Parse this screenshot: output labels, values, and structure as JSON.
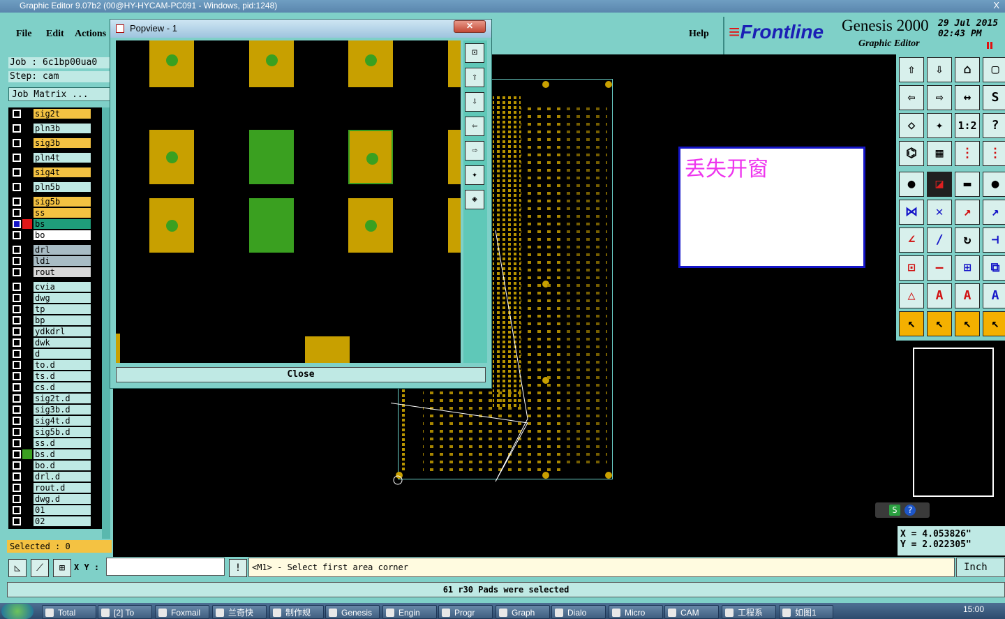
{
  "window": {
    "title": "Graphic Editor 9.07b2 (00@HY-HYCAM-PC091 - Windows, pid:1248)",
    "close_glyph": "X"
  },
  "menu": {
    "items": [
      "File",
      "Edit",
      "Actions"
    ],
    "help": "Help"
  },
  "brand": {
    "logo": "Frontline",
    "product": "Genesis 2000",
    "subtitle": "Graphic Editor",
    "date": "29 Jul 2015",
    "time": "02:43 PM"
  },
  "job": {
    "job_line": "Job : 6c1bp00ua0",
    "step_line": "Step: cam",
    "matrix_button": "Job Matrix ..."
  },
  "layers": [
    {
      "name": "sig2t",
      "bg": "#f4c242",
      "color": "#000000",
      "checked": false
    },
    {
      "name": "pln3b",
      "bg": "#bfe9e4",
      "color": "#000000",
      "checked": false
    },
    {
      "name": "sig3b",
      "bg": "#f4c242",
      "color": "#000000",
      "checked": false
    },
    {
      "name": "pln4t",
      "bg": "#bfe9e4",
      "color": "#000000",
      "checked": false
    },
    {
      "name": "sig4t",
      "bg": "#f4c242",
      "color": "#000000",
      "checked": false
    },
    {
      "name": "pln5b",
      "bg": "#bfe9e4",
      "color": "#000000",
      "checked": false
    },
    {
      "name": "sig5b",
      "bg": "#f4c242",
      "color": "#000000",
      "checked": false
    },
    {
      "name": "ss",
      "bg": "#f4c242",
      "color": "#000000",
      "checked": false
    },
    {
      "name": "bs",
      "bg": "#1f9e7a",
      "color": "#e01818",
      "checked": true
    },
    {
      "name": "bo",
      "bg": "#ffffff",
      "color": "#000000",
      "checked": false
    },
    {
      "name": "drl",
      "bg": "#a8bcc4",
      "color": "#000000",
      "checked": false
    },
    {
      "name": "ldi",
      "bg": "#a8bcc4",
      "color": "#000000",
      "checked": false
    },
    {
      "name": "rout",
      "bg": "#d8d8d8",
      "color": "#000000",
      "checked": false
    },
    {
      "name": "cvia",
      "bg": "#bfe9e4",
      "color": "#000000",
      "checked": false
    },
    {
      "name": "dwg",
      "bg": "#bfe9e4",
      "color": "#000000",
      "checked": false
    },
    {
      "name": "tp",
      "bg": "#bfe9e4",
      "color": "#000000",
      "checked": false
    },
    {
      "name": "bp",
      "bg": "#bfe9e4",
      "color": "#000000",
      "checked": false
    },
    {
      "name": "ydkdrl",
      "bg": "#bfe9e4",
      "color": "#000000",
      "checked": false
    },
    {
      "name": "dwk",
      "bg": "#bfe9e4",
      "color": "#000000",
      "checked": false
    },
    {
      "name": "d",
      "bg": "#bfe9e4",
      "color": "#000000",
      "checked": false
    },
    {
      "name": "to.d",
      "bg": "#bfe9e4",
      "color": "#000000",
      "checked": false
    },
    {
      "name": "ts.d",
      "bg": "#bfe9e4",
      "color": "#000000",
      "checked": false
    },
    {
      "name": "cs.d",
      "bg": "#bfe9e4",
      "color": "#000000",
      "checked": false
    },
    {
      "name": "sig2t.d",
      "bg": "#bfe9e4",
      "color": "#000000",
      "checked": false
    },
    {
      "name": "sig3b.d",
      "bg": "#bfe9e4",
      "color": "#000000",
      "checked": false
    },
    {
      "name": "sig4t.d",
      "bg": "#bfe9e4",
      "color": "#000000",
      "checked": false
    },
    {
      "name": "sig5b.d",
      "bg": "#bfe9e4",
      "color": "#000000",
      "checked": false
    },
    {
      "name": "ss.d",
      "bg": "#bfe9e4",
      "color": "#000000",
      "checked": false
    },
    {
      "name": "bs.d",
      "bg": "#bfe9e4",
      "color": "#3aa020",
      "checked": false
    },
    {
      "name": "bo.d",
      "bg": "#bfe9e4",
      "color": "#000000",
      "checked": false
    },
    {
      "name": "drl.d",
      "bg": "#bfe9e4",
      "color": "#000000",
      "checked": false
    },
    {
      "name": "rout.d",
      "bg": "#bfe9e4",
      "color": "#000000",
      "checked": false
    },
    {
      "name": "dwg.d",
      "bg": "#bfe9e4",
      "color": "#000000",
      "checked": false
    },
    {
      "name": "01",
      "bg": "#bfe9e4",
      "color": "#000000",
      "checked": false
    },
    {
      "name": "02",
      "bg": "#bfe9e4",
      "color": "#000000",
      "checked": false
    }
  ],
  "selected": "Selected : 0",
  "popview": {
    "title": "Popview - 1",
    "close_label": "Close",
    "close_x": "✕",
    "pads": [
      {
        "kind": "pad-with-hole"
      },
      {
        "kind": "pad-with-hole"
      },
      {
        "kind": "pad-with-hole"
      },
      {
        "kind": "pad-with-hole"
      },
      {
        "kind": "exposed-pad"
      },
      {
        "kind": "highlighted-pad"
      },
      {
        "kind": "pad-with-hole"
      },
      {
        "kind": "exposed-pad"
      },
      {
        "kind": "pad-with-hole"
      }
    ]
  },
  "note": {
    "text": "丢失开窗"
  },
  "coordinates": {
    "x": "X = 4.053826\"",
    "y": "Y = 2.022305\""
  },
  "bottom": {
    "xy_label": "X Y :",
    "prompt": "<M1> - Select first area corner",
    "unit": "Inch",
    "status": "61 r30 Pads were selected"
  },
  "taskbar": {
    "items": [
      "Total",
      "[2] To",
      "Foxmail",
      "兰奇快",
      "制作规",
      "Genesis",
      "Engin",
      "Progr",
      "Graph",
      "Dialo",
      "Micro",
      "CAM",
      "工程系",
      "如图1"
    ],
    "clock": "15:00"
  },
  "colors": {
    "panel": "#7fd0c8",
    "field": "#bfe9e4",
    "pad_gold": "#c8a000",
    "pad_green": "#3aa020",
    "note_border": "#1515c8",
    "note_text": "#ee35ee"
  }
}
